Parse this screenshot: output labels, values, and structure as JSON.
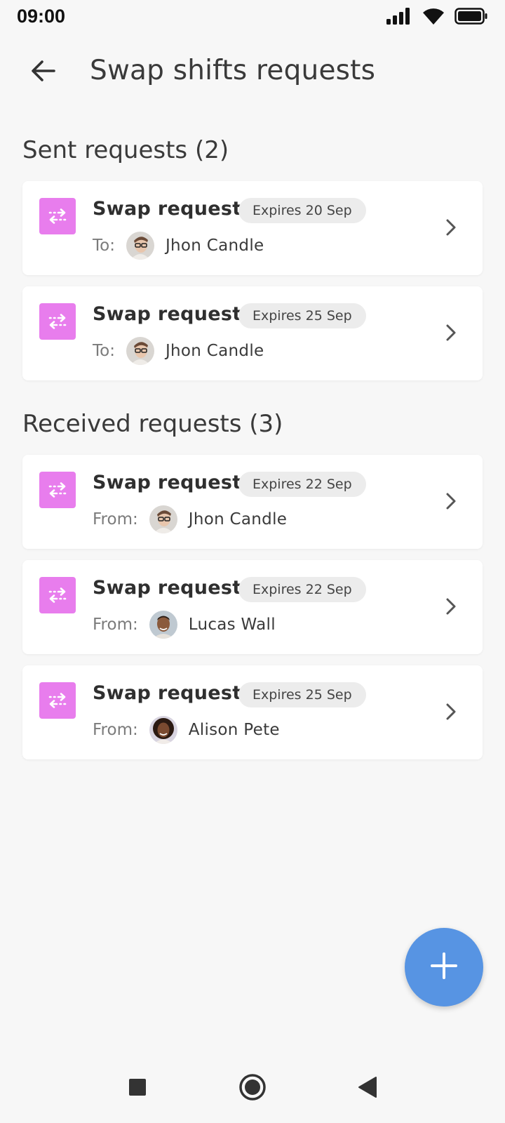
{
  "status_bar": {
    "time": "09:00"
  },
  "header": {
    "title": "Swap shifts requests"
  },
  "sections": {
    "sent": {
      "title": "Sent requests (2)"
    },
    "received": {
      "title": "Received requests (3)"
    }
  },
  "sent_requests": [
    {
      "title": "Swap request",
      "expires": "Expires 20 Sep",
      "direction": "To:",
      "name": "Jhon Candle"
    },
    {
      "title": "Swap request",
      "expires": "Expires 25 Sep",
      "direction": "To:",
      "name": "Jhon Candle"
    }
  ],
  "received_requests": [
    {
      "title": "Swap request",
      "expires": "Expires 22 Sep",
      "direction": "From:",
      "name": "Jhon Candle"
    },
    {
      "title": "Swap request",
      "expires": "Expires 22 Sep",
      "direction": "From:",
      "name": "Lucas Wall"
    },
    {
      "title": "Swap request",
      "expires": "Expires 25 Sep",
      "direction": "From:",
      "name": "Alison Pete"
    }
  ],
  "icons": {
    "back": "arrow-left-icon",
    "swap": "swap-arrows-icon",
    "chevron": "chevron-right-icon",
    "fab": "plus-icon",
    "nav": [
      "square-icon",
      "circle-icon",
      "triangle-back-icon"
    ]
  },
  "colors": {
    "background": "#f7f7f7",
    "swap_tile": "#e87ded",
    "fab": "#5794e3",
    "badge_bg": "#ececec"
  }
}
